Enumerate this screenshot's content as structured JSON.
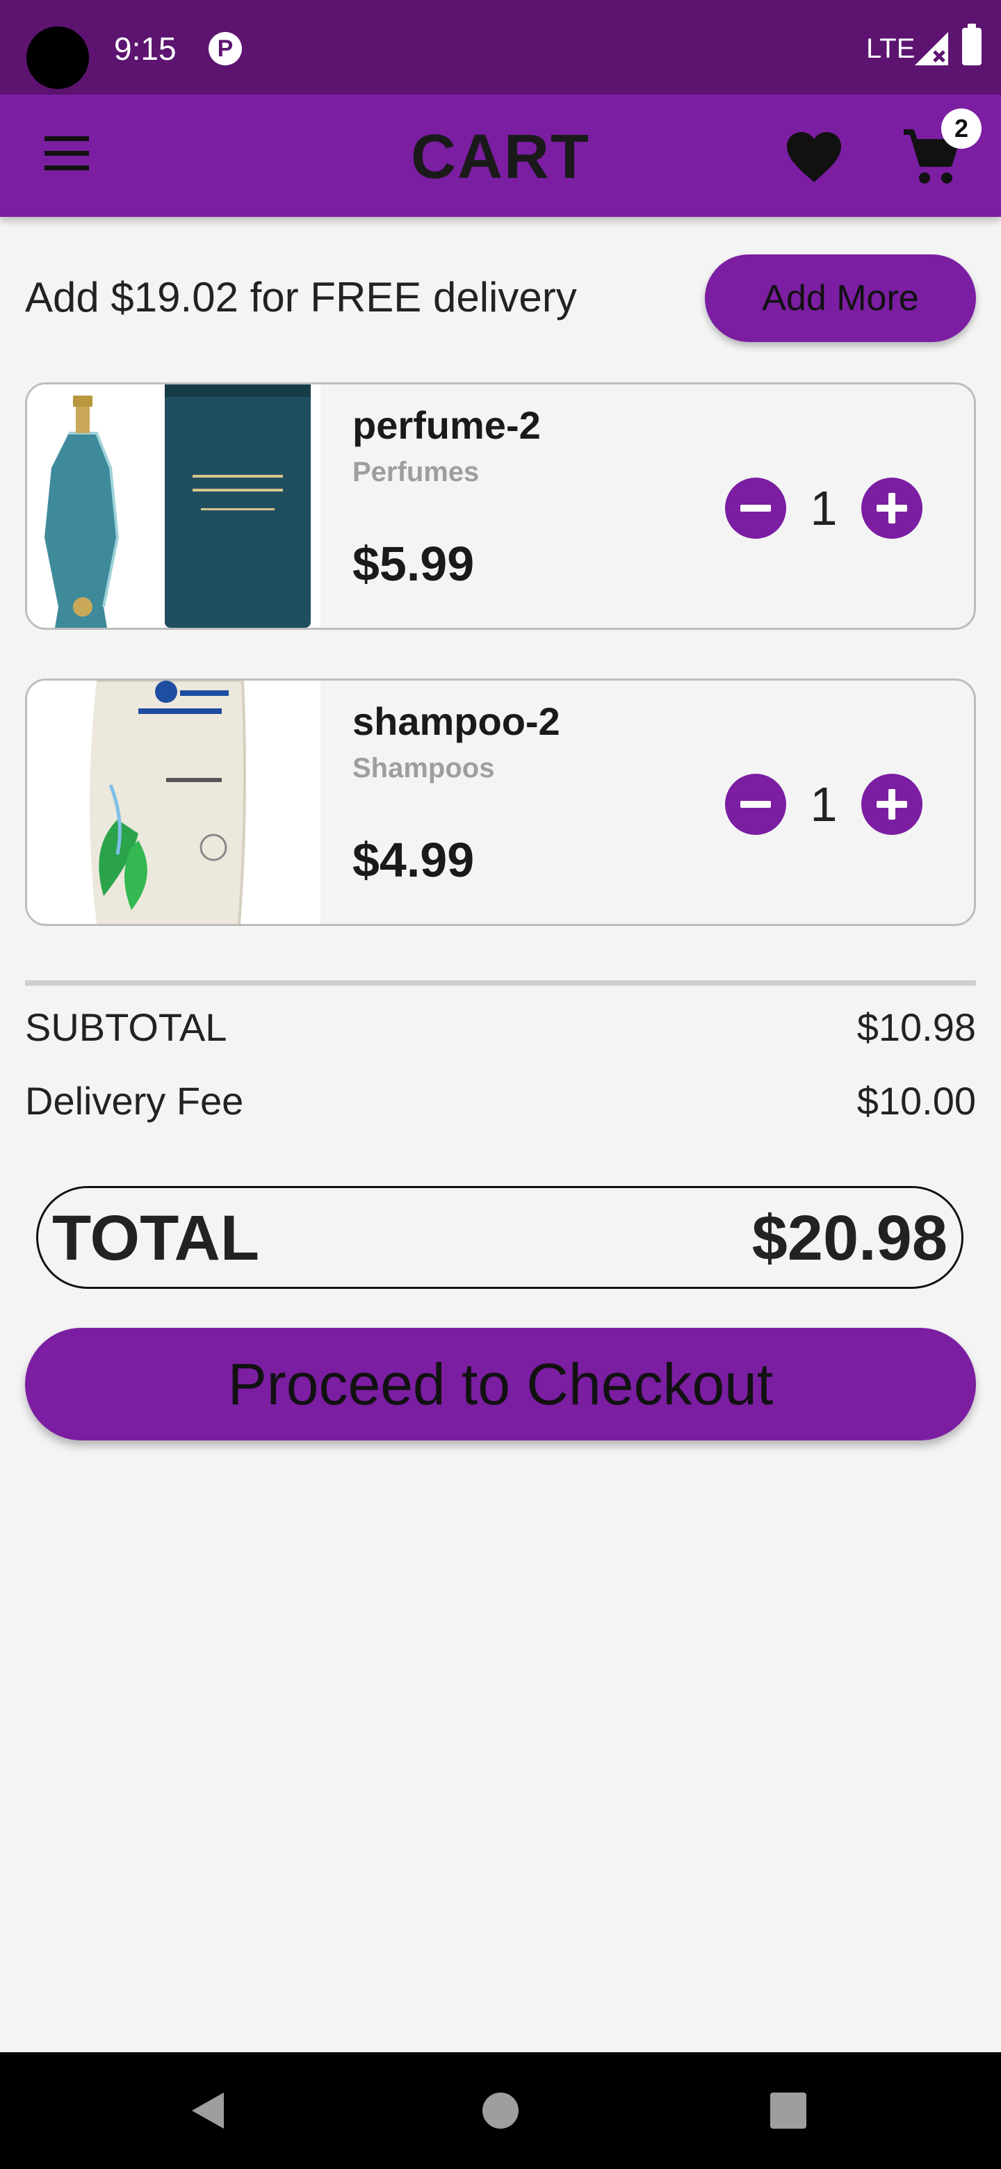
{
  "status_bar": {
    "time": "9:15",
    "network": "LTE"
  },
  "header": {
    "title": "CART",
    "cart_badge_count": "2"
  },
  "delivery_banner": {
    "message": "Add $19.02 for FREE delivery",
    "add_more_label": "Add More"
  },
  "cart": {
    "items": [
      {
        "name": "perfume-2",
        "category": "Perfumes",
        "price": "$5.99",
        "quantity": "1"
      },
      {
        "name": "shampoo-2",
        "category": "Shampoos",
        "price": "$4.99",
        "quantity": "1"
      }
    ]
  },
  "summary": {
    "subtotal_label": "SUBTOTAL",
    "subtotal_value": "$10.98",
    "delivery_label": "Delivery Fee",
    "delivery_value": "$10.00",
    "total_label": "TOTAL",
    "total_value": "$20.98"
  },
  "checkout": {
    "label": "Proceed to Checkout"
  },
  "colors": {
    "accent": "#7b1ea2",
    "status_bar": "#5c1470",
    "background": "#f4f4f4"
  },
  "icons": {
    "menu": "hamburger-menu-icon",
    "wishlist": "heart-icon",
    "cart": "shopping-cart-icon",
    "decrease": "minus-icon",
    "increase": "plus-icon"
  }
}
